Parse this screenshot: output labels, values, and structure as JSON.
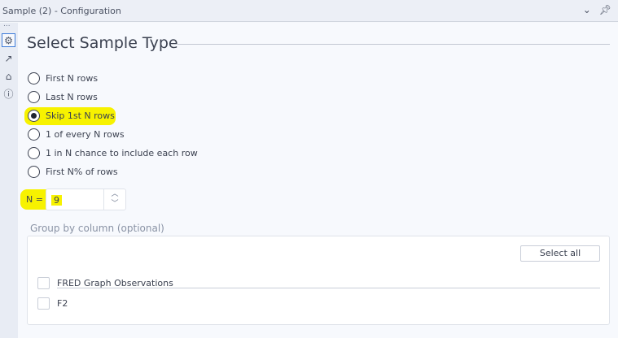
{
  "window": {
    "title": "Sample (2) - Configuration",
    "collapse_icon": "chevron-down-icon",
    "pin_icon": "pin-icon"
  },
  "sidebar": {
    "more": "...",
    "items": [
      {
        "icon": "gear-icon",
        "selected": true
      },
      {
        "icon": "output-arrow-icon"
      },
      {
        "icon": "tag-icon"
      },
      {
        "icon": "help-icon"
      }
    ]
  },
  "section": {
    "title": "Select Sample Type"
  },
  "options": [
    {
      "label": "First N rows",
      "selected": false
    },
    {
      "label": "Last N rows",
      "selected": false
    },
    {
      "label": "Skip 1st N rows",
      "selected": true
    },
    {
      "label": "1 of every N rows",
      "selected": false
    },
    {
      "label": "1 in N chance to include each row",
      "selected": false
    },
    {
      "label": "First N% of rows",
      "selected": false
    }
  ],
  "n": {
    "label": "N =",
    "value": "9"
  },
  "group": {
    "label": "Group by column (optional)",
    "select_all": "Select all",
    "columns": [
      {
        "label": "FRED Graph Observations",
        "checked": false
      },
      {
        "label": "F2",
        "checked": false
      }
    ]
  },
  "highlight_color": "#f7f200"
}
